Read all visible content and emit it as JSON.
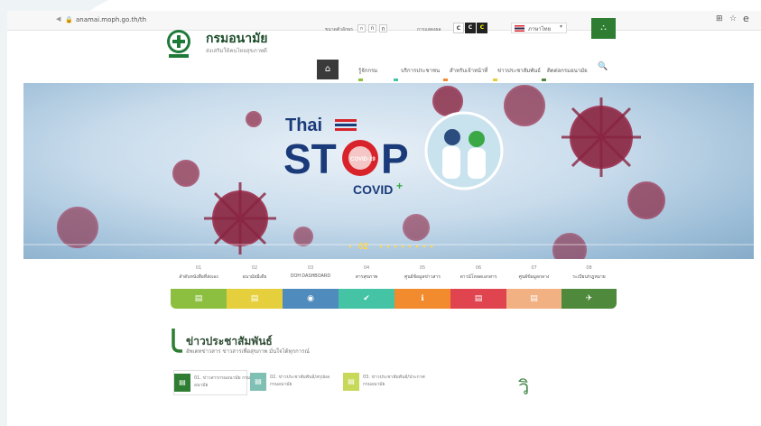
{
  "browser": {
    "url": "anamai.moph.go.th/th",
    "tabs_hint": ""
  },
  "header": {
    "title": "กรมอนามัย",
    "subtitle": "ส่งเสริมให้คนไทยสุขภาพดี",
    "fontsize_label": "ขนาดตัวอักษร",
    "fontsize_opts": [
      "ก",
      "ก",
      "ก"
    ],
    "contrast_label": "การแสดงผล",
    "contrast_opts": [
      "C",
      "C",
      "C"
    ],
    "language": "ภาษาไทย"
  },
  "nav": {
    "items": [
      "รู้จักกรม",
      "บริการประชาชน",
      "สำหรับเจ้าหน้าที่",
      "ข่าวประชาสัมพันธ์",
      "ติดต่อกรมอนามัย"
    ]
  },
  "banner": {
    "title_top": "Thai",
    "title_main_a": "ST",
    "title_main_b": "P",
    "title_bottom": "COVID",
    "badge": "COVID-19",
    "slide_number": "02"
  },
  "tiles": [
    {
      "num": "01",
      "label": "ลำดับหนังสือที่ส่งเอง"
    },
    {
      "num": "02",
      "label": "อนามัยมีเดีย"
    },
    {
      "num": "03",
      "label": "DOH DASHBOARD"
    },
    {
      "num": "04",
      "label": "สารสุขภาพ"
    },
    {
      "num": "05",
      "label": "ศูนย์ข้อมูลข่าวสาร"
    },
    {
      "num": "06",
      "label": "ดาวน์โหลดเอกสาร"
    },
    {
      "num": "07",
      "label": "ศูนย์ข้อมูลกลาง"
    },
    {
      "num": "08",
      "label": "ระเบียบ/กฎหมาย"
    }
  ],
  "tile_colors": [
    "#8cbf3f",
    "#e6cf3c",
    "#4f8bbd",
    "#45c3a5",
    "#f28a2e",
    "#e0454f",
    "#f2b183",
    "#4f8a3c"
  ],
  "tile_icons": [
    "▤",
    "▤",
    "◉",
    "✔",
    "ℹ",
    "▤",
    "▤",
    "✈"
  ],
  "press": {
    "heading": "ข่าวประชาสัมพันธ์",
    "subheading": "อัพเดทข่าวสาร ข่าวสารเพื่อสุขภาพ มั่นใจได้ทุกการณ์",
    "tabs": [
      {
        "label": "01. ข่าวสารกรมอนามัย กรมอนามัย",
        "color": "#2e7d32"
      },
      {
        "label": "02. ข่าวประชาสัมพันธ์/สรุปผล กรมอนามัย",
        "color": "#7fbfb4"
      },
      {
        "label": "03. ข่าวประชาสัมพันธ์/ประกาศ กรมอนามัย",
        "color": "#c8d95a"
      }
    ],
    "extra_char": "วิ"
  }
}
